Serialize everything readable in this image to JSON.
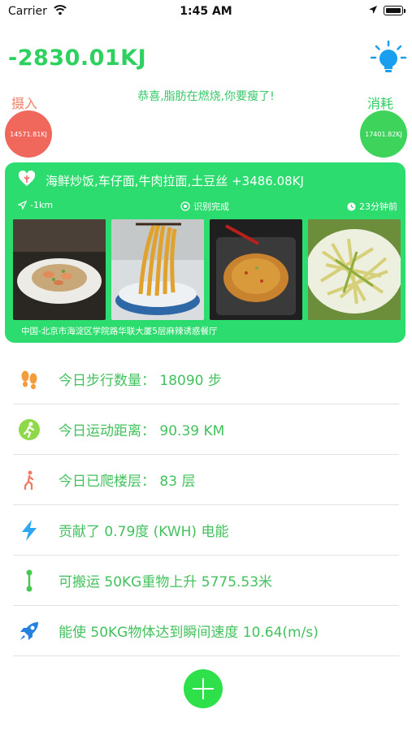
{
  "status_bar": {
    "carrier": "Carrier",
    "time": "1:45 AM"
  },
  "summary": {
    "net_energy": "-2830.01KJ",
    "message": "恭喜,脂肪在燃烧,你要瘦了!",
    "intake_label": "摄入",
    "intake_value": "14571.81KJ",
    "burn_label": "消耗",
    "burn_value": "17401.82KJ"
  },
  "meal": {
    "foods": "海鲜炒饭,车仔面,牛肉拉面,土豆丝 +3486.08KJ",
    "distance": "-1km",
    "recognition": "识别完成",
    "time_ago": "23分钟前",
    "photos": [
      "seafood-fried-rice-photo",
      "noodles-photo",
      "fried-rice-photo",
      "potato-shreds-photo"
    ],
    "address": "中国-北京市海淀区学院路华联大厦5层麻辣诱惑餐厅"
  },
  "stats": [
    {
      "icon": "footprints-icon",
      "text": "今日步行数量：  18090 步"
    },
    {
      "icon": "runner-icon",
      "text": "今日运动距离：  90.39 KM"
    },
    {
      "icon": "stair-climber-icon",
      "text": "今日已爬楼层：  83 层"
    },
    {
      "icon": "lightning-icon",
      "text": "贡献了 0.79度 (KWH) 电能"
    },
    {
      "icon": "vertical-distance-icon",
      "text": "可搬运 50KG重物上升 5775.53米"
    },
    {
      "icon": "rocket-icon",
      "text": "能使 50KG物体达到瞬间速度 10.64(m/s)"
    }
  ],
  "colors": {
    "accent_green": "#2ddc6e",
    "intake_red": "#f0675c",
    "text_green": "#43c15d"
  }
}
